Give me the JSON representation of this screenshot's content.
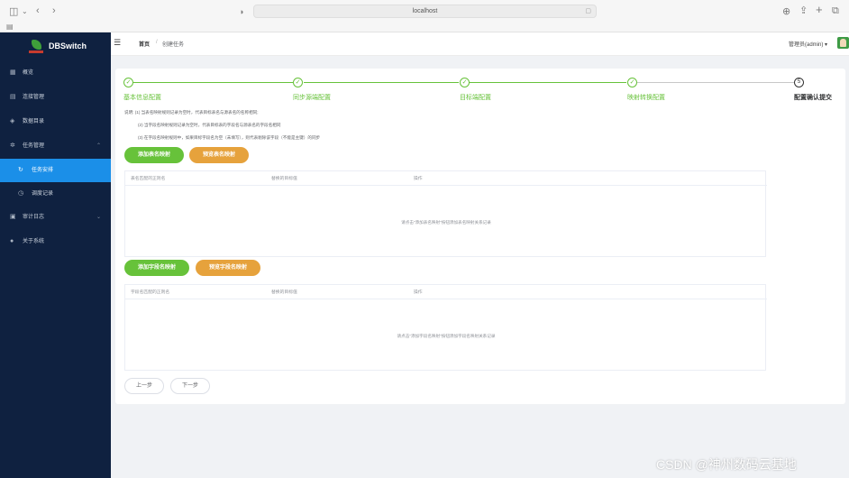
{
  "browser": {
    "url": "localhost",
    "lock_icon": "document-icon",
    "sidebar_toggle_icon": "sidebar-icon",
    "nav_back_icon": "back-icon",
    "nav_forward_icon": "forward-icon",
    "actions": [
      "download-icon",
      "share-icon",
      "new-tab-icon",
      "tabs-icon"
    ]
  },
  "app": {
    "name": "DBSwitch"
  },
  "sidebar": {
    "items": [
      {
        "label": "概览",
        "icon": "grid-icon"
      },
      {
        "label": "连接管理",
        "icon": "database-icon"
      },
      {
        "label": "数据目录",
        "icon": "layers-icon"
      },
      {
        "label": "任务管理",
        "icon": "gear-icon",
        "arrow": "⌃"
      },
      {
        "label": "任务安排",
        "icon": "refresh-icon",
        "active": true
      },
      {
        "label": "调度记录",
        "icon": "clock-icon"
      },
      {
        "label": "审计日志",
        "icon": "calendar-icon",
        "arrow": "⌄"
      },
      {
        "label": "关于系统",
        "icon": "user-icon"
      }
    ]
  },
  "topbar": {
    "breadcrumb": [
      "首页",
      "创建任务"
    ],
    "user": "管理员(admin) ▾"
  },
  "steps": [
    {
      "label": "基本信息配置",
      "mark": "✓",
      "status": "done"
    },
    {
      "label": "同步源端配置",
      "mark": "✓",
      "status": "done"
    },
    {
      "label": "目标端配置",
      "mark": "✓",
      "status": "done"
    },
    {
      "label": "映射转换配置",
      "mark": "✓",
      "status": "done"
    },
    {
      "label": "配置确认提交",
      "mark": "5",
      "status": "current"
    }
  ],
  "notes": [
    "说明: (1) 当表名映射规则记录为空时，代表目标表名与源表名的名称相同;",
    "(2) 当字段名映射规则记录为空时，代表目标表的字段名与源表名的字段名相同",
    "(3) 在字段名映射规则中，如果目标字段名为空（未填写），则代表剔除该字段（不能是主键）的同步"
  ],
  "table_mapping": {
    "add_button": "添加表名映射",
    "preview_button": "预览表名映射",
    "columns": [
      "表名匹配的正则名",
      "替换的目标值",
      "操作"
    ],
    "empty_text": "请点击\"添加表名映射\"按钮添加表名映射关系记录"
  },
  "field_mapping": {
    "add_button": "添加字段名映射",
    "preview_button": "预览字段名映射",
    "columns": [
      "字段名匹配的正则名",
      "替换的目标值",
      "操作"
    ],
    "empty_text": "请点击\"添加字段名映射\"按钮添加字段名映射关系记录"
  },
  "footer_buttons": {
    "prev": "上一步",
    "next": "下一步"
  },
  "watermark": "CSDN @神州数码云基地",
  "colors": {
    "sidebar_bg": "#0f2140",
    "active_menu": "#1b8fe8",
    "green": "#67c23a",
    "orange": "#e6a23c"
  }
}
